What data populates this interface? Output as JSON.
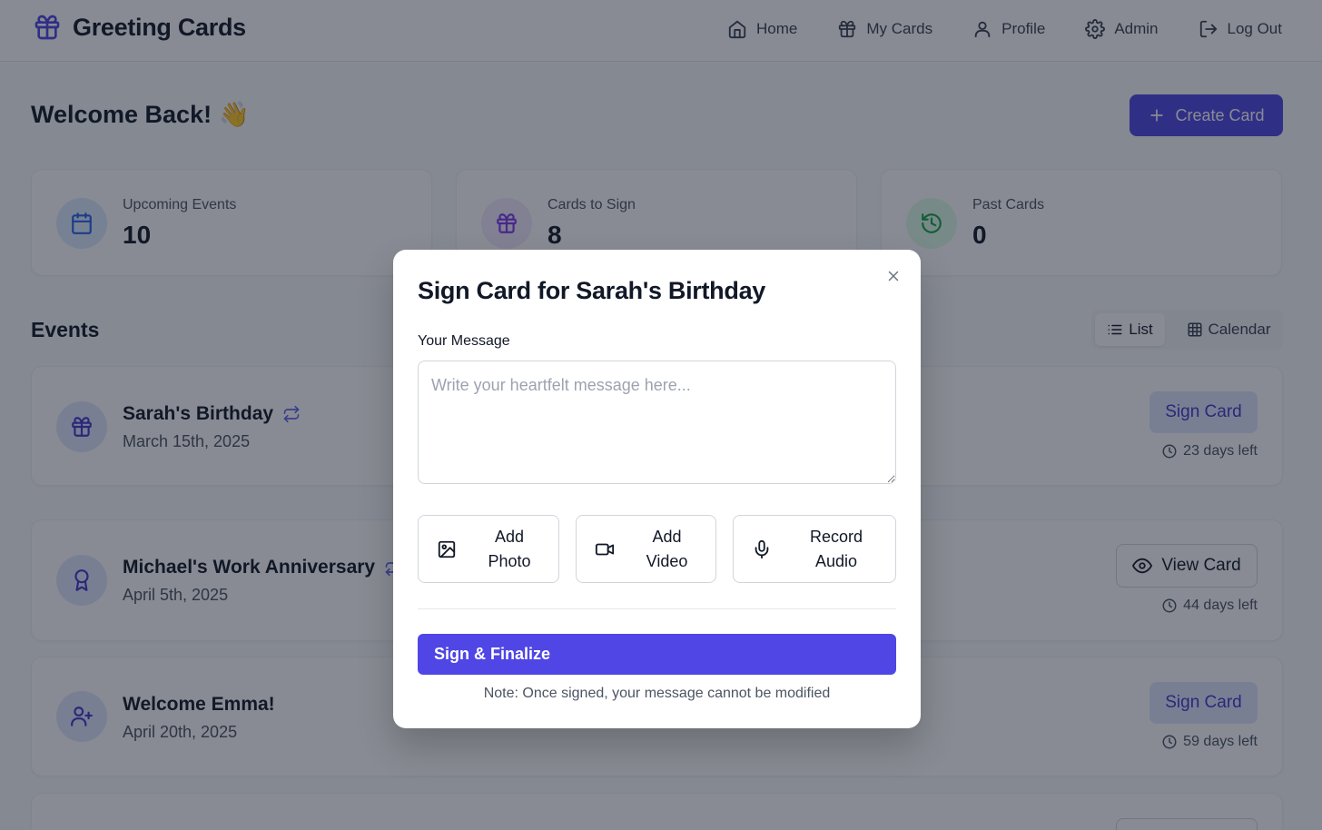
{
  "header": {
    "brand": "Greeting Cards",
    "nav": [
      {
        "label": "Home",
        "icon": "home-icon"
      },
      {
        "label": "My Cards",
        "icon": "gift-icon"
      },
      {
        "label": "Profile",
        "icon": "user-icon"
      },
      {
        "label": "Admin",
        "icon": "gear-icon"
      },
      {
        "label": "Log Out",
        "icon": "logout-icon"
      }
    ]
  },
  "welcome": {
    "title": "Welcome Back!",
    "emoji": "👋"
  },
  "create_button": {
    "label": "Create Card",
    "icon": "plus-icon"
  },
  "stats": [
    {
      "label": "Upcoming Events",
      "value": "10",
      "icon": "calendar-icon",
      "color": "#2563eb"
    },
    {
      "label": "Cards to Sign",
      "value": "8",
      "icon": "gift-icon",
      "color": "#7c3aed"
    },
    {
      "label": "Past Cards",
      "value": "0",
      "icon": "history-icon",
      "color": "#16a34a"
    }
  ],
  "events_section": {
    "title": "Events",
    "toggle": {
      "list": "List",
      "calendar": "Calendar",
      "selected": "List"
    }
  },
  "events": [
    {
      "name": "Sarah's Birthday",
      "date": "March 15th, 2025",
      "recurring": true,
      "action": "Sign Card",
      "days_left": "23 days left",
      "icon": "gift-icon"
    },
    {
      "name": "Michael's Work Anniversary",
      "date": "April 5th, 2025",
      "recurring": true,
      "action": "View Card",
      "days_left": "44 days left",
      "icon": "award-icon"
    },
    {
      "name": "Welcome Emma!",
      "date": "April 20th, 2025",
      "recurring": false,
      "action": "Sign Card",
      "days_left": "59 days left",
      "icon": "user-plus-icon"
    }
  ],
  "modal": {
    "title": "Sign Card for Sarah's Birthday",
    "message_label": "Your Message",
    "message_placeholder": "Write your heartfelt message here...",
    "message_value": "",
    "media_buttons": [
      {
        "line1": "Add",
        "line2": "Photo",
        "icon": "image-icon"
      },
      {
        "line1": "Add",
        "line2": "Video",
        "icon": "video-icon"
      },
      {
        "line1": "Record",
        "line2": "Audio",
        "icon": "microphone-icon"
      }
    ],
    "finalize_label": "Sign & Finalize",
    "note": "Note: Once signed, your message cannot be modified"
  },
  "colors": {
    "accent": "#4f46e5",
    "accent_light": "#e0e7ff",
    "overlay": "rgba(17,24,39,0.5)"
  }
}
